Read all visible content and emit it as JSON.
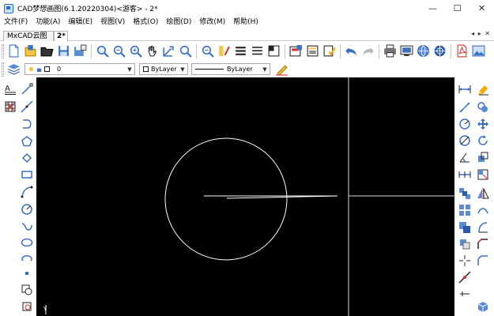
{
  "window": {
    "title": "CAD梦想画图(6.1.20220304)<游客> - 2*",
    "minimize": "—",
    "maximize": "☐",
    "close": "✕"
  },
  "menu": [
    {
      "label": "文件(F)"
    },
    {
      "label": "功能(A)"
    },
    {
      "label": "编辑(E)"
    },
    {
      "label": "视图(V)"
    },
    {
      "label": "格式(O)"
    },
    {
      "label": "绘图(D)"
    },
    {
      "label": "修改(M)"
    },
    {
      "label": "帮助(H)"
    }
  ],
  "tabs": {
    "doc_tab": "MxCAD云图",
    "active_tab": "2*",
    "nav": "◂ ▸ ✕"
  },
  "toolbar": [
    {
      "icon": "new-file-icon"
    },
    {
      "icon": "open-folder-icon"
    },
    {
      "icon": "open-file-icon"
    },
    {
      "icon": "save-icon"
    },
    {
      "icon": "save-as-icon"
    },
    {
      "icon": "zoom-window-icon"
    },
    {
      "icon": "zoom-realtime-icon"
    },
    {
      "icon": "zoom-all-icon"
    },
    {
      "icon": "pan-hand-icon"
    },
    {
      "icon": "zoom-extents-icon"
    },
    {
      "icon": "zoom-previous-icon"
    },
    {
      "icon": "zoom-out-icon"
    },
    {
      "icon": "match-properties-icon"
    },
    {
      "icon": "layer-manager-icon"
    },
    {
      "icon": "linetype-icon"
    },
    {
      "icon": "block-icon"
    },
    {
      "icon": "insert-image-icon"
    },
    {
      "icon": "text-style-icon"
    },
    {
      "icon": "check-list-icon"
    },
    {
      "icon": "undo-icon"
    },
    {
      "icon": "redo-icon"
    },
    {
      "icon": "print-icon"
    },
    {
      "icon": "share-icon"
    },
    {
      "icon": "globe-icon"
    },
    {
      "icon": "web-icon"
    },
    {
      "icon": "export-pdf-icon"
    },
    {
      "icon": "export-image-icon"
    }
  ],
  "properties": {
    "layer_value": "0",
    "color_value": "ByLayer",
    "linetype_value": "ByLayer"
  },
  "canvas_axis_label": "Y"
}
